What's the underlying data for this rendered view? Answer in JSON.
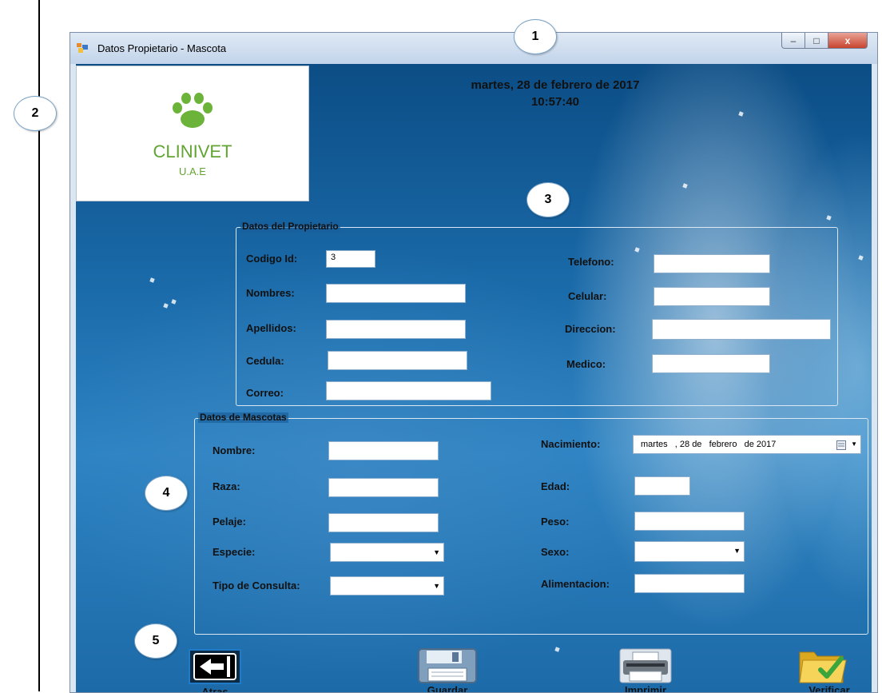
{
  "callouts": [
    "1",
    "2",
    "3",
    "4",
    "5"
  ],
  "window": {
    "title": "Datos Propietario - Mascota",
    "controls": {
      "minimize": "–",
      "maximize": "□",
      "close": "x"
    }
  },
  "logo": {
    "name": "CLINIVET",
    "subtitle": "U.A.E",
    "icon": "paw-icon",
    "color": "#62a433"
  },
  "header": {
    "date": "martes, 28 de febrero de 2017",
    "time": "10:57:40"
  },
  "owner": {
    "legend": "Datos del Propietario",
    "codigo_label": "Codigo Id:",
    "codigo_value": "3",
    "nombres_label": "Nombres:",
    "nombres_value": "",
    "apellidos_label": "Apellidos:",
    "apellidos_value": "",
    "cedula_label": "Cedula:",
    "cedula_value": "",
    "correo_label": "Correo:",
    "correo_value": "",
    "telefono_label": "Telefono:",
    "telefono_value": "",
    "celular_label": "Celular:",
    "celular_value": "",
    "direccion_label": "Direccion:",
    "direccion_value": "",
    "medico_label": "Medico:",
    "medico_value": ""
  },
  "pet": {
    "legend": "Datos de Mascotas",
    "nombre_label": "Nombre:",
    "nombre_value": "",
    "raza_label": "Raza:",
    "raza_value": "",
    "pelaje_label": "Pelaje:",
    "pelaje_value": "",
    "especie_label": "Especie:",
    "especie_value": "",
    "tipo_label": "Tipo de Consulta:",
    "tipo_value": "",
    "nacimiento_label": "Nacimiento:",
    "nacimiento_value": "martes   , 28 de   febrero   de 2017",
    "edad_label": "Edad:",
    "edad_value": "",
    "peso_label": "Peso:",
    "peso_value": "",
    "sexo_label": "Sexo:",
    "sexo_value": "",
    "alimentacion_label": "Alimentacion:",
    "alimentacion_value": ""
  },
  "actions": {
    "back": "Atras",
    "save": "Guardar",
    "print": "Imprimir",
    "verify": "Verificar"
  },
  "colors": {
    "background": "#1a6aa9",
    "close_button": "#c8452e"
  }
}
